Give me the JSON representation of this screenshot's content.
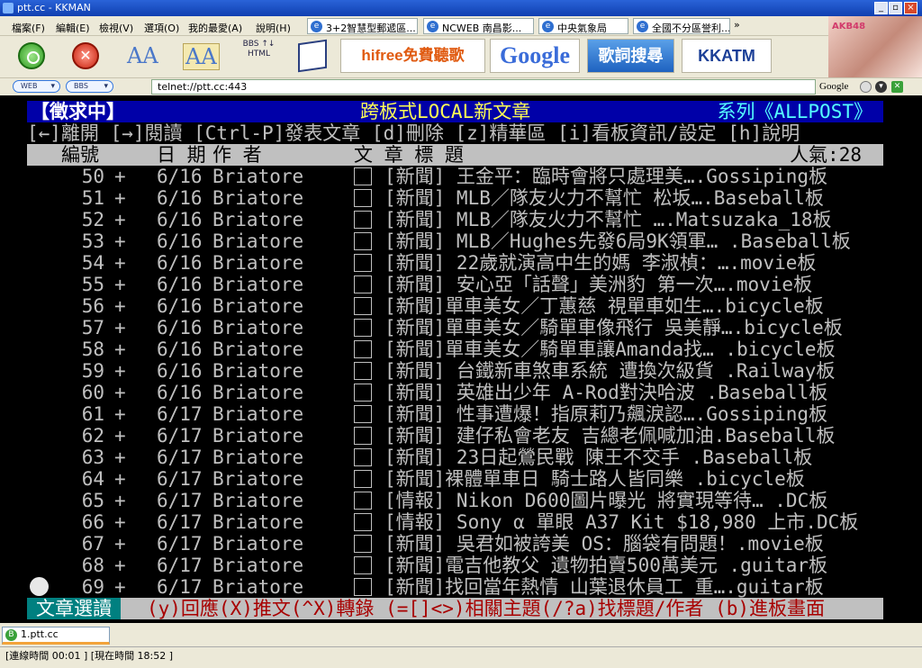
{
  "window": {
    "title": "ptt.cc - KKMAN",
    "min": "_",
    "max": "▫",
    "close": "×"
  },
  "menu": [
    "檔案(F)",
    "編輯(E)",
    "檢視(V)",
    "選項(O)",
    "我的最愛(A)",
    "說明(H)"
  ],
  "quick_tabs": [
    {
      "label": "3+2智慧型郵遞區...",
      "icon": "ie-icon"
    },
    {
      "label": "NCWEB 南昌影...",
      "icon": "ie-icon"
    },
    {
      "label": "中央氣象局",
      "icon": "ie-icon"
    },
    {
      "label": "全國不分區誉利...",
      "icon": "ie-icon"
    }
  ],
  "more_chevron": "»",
  "toolbar": {
    "go_icon": "go-icon",
    "stop_icon": "stop-icon",
    "stop_glyph": "✕",
    "font_icon_1": "AA",
    "font_icon_2": "AA",
    "bbs_icon": "BBS ↑↓ HTML",
    "ads": [
      "hifree免費聽歌",
      "Google",
      "歌詞搜尋",
      "KKATM"
    ]
  },
  "brand_mark": "AKB48",
  "address": {
    "web_pill": "WEB",
    "bbs_pill": "BBS",
    "url": "telnet://ptt.cc:443",
    "engine": "Google"
  },
  "terminal": {
    "header_tag": "【徵求中】",
    "board_title": "跨板式LOCAL新文章",
    "series": "系列《ALLPOST》",
    "help": "[←]離開 [→]閱讀 [Ctrl-P]發表文章 [d]刪除 [z]精華區 [i]看板資訊/設定 [h]說明",
    "columns": {
      "num": "編號",
      "date": "日 期",
      "author": "作  者",
      "title": "文  章  標  題",
      "popularity": "人氣:28"
    },
    "articles": [
      {
        "num": "50",
        "mark": "+",
        "date": "6/16",
        "author": "Briatore",
        "title": "[新聞] 王金平：臨時會將只處理美….Gossiping板"
      },
      {
        "num": "51",
        "mark": "+",
        "date": "6/16",
        "author": "Briatore",
        "title": "[新聞] MLB／隊友火力不幫忙  松坂….Baseball板"
      },
      {
        "num": "52",
        "mark": "+",
        "date": "6/16",
        "author": "Briatore",
        "title": "[新聞] MLB／隊友火力不幫忙   ….Matsuzaka_18板"
      },
      {
        "num": "53",
        "mark": "+",
        "date": "6/16",
        "author": "Briatore",
        "title": "[新聞] MLB／Hughes先發6局9K領軍… .Baseball板"
      },
      {
        "num": "54",
        "mark": "+",
        "date": "6/16",
        "author": "Briatore",
        "title": "[新聞] 22歲就演高中生的媽  李淑楨：….movie板"
      },
      {
        "num": "55",
        "mark": "+",
        "date": "6/16",
        "author": "Briatore",
        "title": "[新聞] 安心亞「話聲」美洲豹  第一次….movie板"
      },
      {
        "num": "56",
        "mark": "+",
        "date": "6/16",
        "author": "Briatore",
        "title": "[新聞]單車美女／丁蕙慈  視單車如生….bicycle板"
      },
      {
        "num": "57",
        "mark": "+",
        "date": "6/16",
        "author": "Briatore",
        "title": "[新聞]單車美女／騎單車像飛行  吳美靜….bicycle板"
      },
      {
        "num": "58",
        "mark": "+",
        "date": "6/16",
        "author": "Briatore",
        "title": "[新聞]單車美女／騎單車讓Amanda找… .bicycle板"
      },
      {
        "num": "59",
        "mark": "+",
        "date": "6/16",
        "author": "Briatore",
        "title": "[新聞] 台鐵新車煞車系統  遭換次級貨 .Railway板"
      },
      {
        "num": "60",
        "mark": "+",
        "date": "6/16",
        "author": "Briatore",
        "title": "[新聞] 英雄出少年  A-Rod對決哈波    .Baseball板"
      },
      {
        "num": "61",
        "mark": "+",
        "date": "6/17",
        "author": "Briatore",
        "title": "[新聞] 性事遭爆！指原莉乃飆淚認….Gossiping板"
      },
      {
        "num": "62",
        "mark": "+",
        "date": "6/17",
        "author": "Briatore",
        "title": "[新聞] 建仔私會老友  吉總老佩喊加油.Baseball板"
      },
      {
        "num": "63",
        "mark": "+",
        "date": "6/17",
        "author": "Briatore",
        "title": "[新聞] 23日起鶯民戰  陳王不交手    .Baseball板"
      },
      {
        "num": "64",
        "mark": "+",
        "date": "6/17",
        "author": "Briatore",
        "title": "[新聞]裸體單車日  騎士路人皆同樂    .bicycle板"
      },
      {
        "num": "65",
        "mark": "+",
        "date": "6/17",
        "author": "Briatore",
        "title": "[情報] Nikon D600圖片曝光  將實現等待… .DC板"
      },
      {
        "num": "66",
        "mark": "+",
        "date": "6/17",
        "author": "Briatore",
        "title": "[情報] Sony α 單眼 A37 Kit $18,980 上市.DC板"
      },
      {
        "num": "67",
        "mark": "+",
        "date": "6/17",
        "author": "Briatore",
        "title": "[新聞] 吳君如被誇美  OS：腦袋有問題！.movie板"
      },
      {
        "num": "68",
        "mark": "+",
        "date": "6/17",
        "author": "Briatore",
        "title": "[新聞]電吉他教父  遺物拍賣500萬美元   .guitar板"
      },
      {
        "num": "69",
        "mark": "+",
        "date": "6/17",
        "author": "Briatore",
        "title": "[新聞]找回當年熱情  山葉退休員工  重….guitar板"
      }
    ],
    "footer_label": "文章選讀",
    "footer_help": "(y)回應(X)推文(^X)轉錄 (=[]<>)相關主題(/?a)找標題/作者 (b)進板畫面"
  },
  "tabs": [
    {
      "label": "1.ptt.cc",
      "icon": "bbs-tab-icon",
      "glyph": "B"
    }
  ],
  "status": "[連線時間 00:01 ] [現在時間 18:52 ]",
  "colors": {
    "terminal_bg": "#000000",
    "header_bg": "#0000a8",
    "accent_yellow": "#ffff55",
    "accent_cyan": "#55ffff",
    "footer_teal": "#008080",
    "footer_red": "#a80000"
  }
}
